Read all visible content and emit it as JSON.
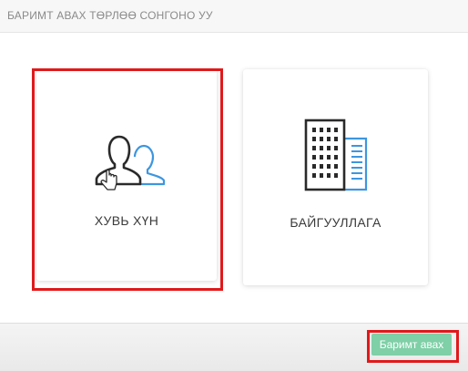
{
  "header": {
    "title": "БАРИМТ АВАХ ТӨРЛӨӨ СОНГОНО УУ"
  },
  "options": {
    "person": {
      "label": "ХУВЬ ХҮН",
      "icon": "person-pair-icon"
    },
    "organization": {
      "label": "БАЙГУУЛЛАГА",
      "icon": "building-icon"
    }
  },
  "footer": {
    "submit_label": "Баримт авах"
  },
  "colors": {
    "highlight": "#e0191b",
    "accent_blue": "#3d96e0",
    "button_green": "#7fcfa7",
    "icon_dark": "#2a2a2a"
  }
}
